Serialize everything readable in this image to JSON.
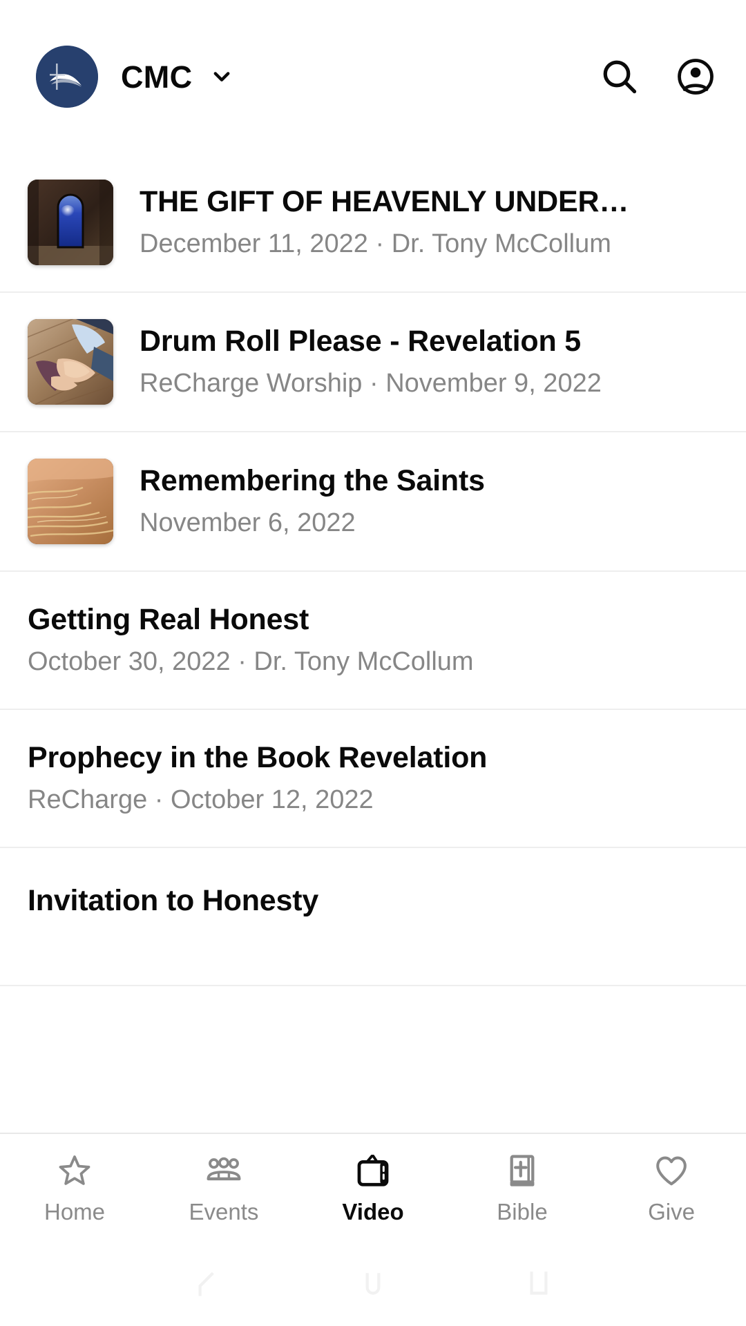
{
  "header": {
    "brand_name": "CMC",
    "logo_icon": "church-swoosh-cross-logo",
    "dropdown_icon": "chevron-down-icon",
    "search_icon": "search-icon",
    "account_icon": "account-circle-icon",
    "logo_bg_color": "#27406e"
  },
  "list": {
    "items": [
      {
        "title": "THE GIFT OF HEAVENLY UNDER…",
        "subtitle": "December 11, 2022 · Dr. Tony McCollum",
        "has_thumbnail": true,
        "thumbnail_desc": "dark-wood-doorway-blue-window"
      },
      {
        "title": "Drum Roll Please - Revelation 5",
        "subtitle": "ReCharge Worship · November 9, 2022",
        "has_thumbnail": true,
        "thumbnail_desc": "clasped-hands-on-bible-wooden-floor"
      },
      {
        "title": "Remembering the Saints",
        "subtitle": "November 6, 2022",
        "has_thumbnail": true,
        "thumbnail_desc": "golden-sunset-water-reflection"
      },
      {
        "title": "Getting Real Honest",
        "subtitle": "October 30, 2022 · Dr. Tony McCollum",
        "has_thumbnail": false,
        "thumbnail_desc": ""
      },
      {
        "title": "Prophecy in the Book Revelation",
        "subtitle": "ReCharge · October 12, 2022",
        "has_thumbnail": false,
        "thumbnail_desc": ""
      },
      {
        "title": "Invitation to Honesty",
        "subtitle": "",
        "has_thumbnail": false,
        "thumbnail_desc": ""
      }
    ]
  },
  "bottom_nav": {
    "active_index": 2,
    "active_color": "#0b0b0b",
    "inactive_color": "#8a8a8a",
    "items": [
      {
        "label": "Home",
        "icon": "star-icon"
      },
      {
        "label": "Events",
        "icon": "people-group-icon"
      },
      {
        "label": "Video",
        "icon": "tv-icon"
      },
      {
        "label": "Bible",
        "icon": "book-cross-icon"
      },
      {
        "label": "Give",
        "icon": "heart-icon"
      }
    ]
  },
  "system_nav": {
    "back_icon": "back-triangle-icon",
    "home_icon": "home-circle-icon",
    "recents_icon": "recents-square-icon"
  }
}
